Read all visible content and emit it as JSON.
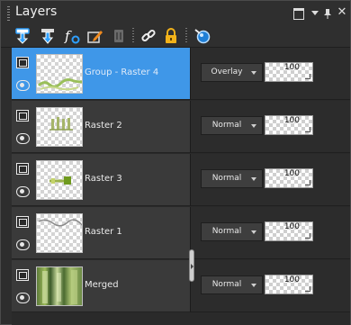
{
  "panel": {
    "title": "Layers",
    "window_buttons": {
      "restore_icon": "restore-window-icon",
      "menu_icon": "chevron-down-icon",
      "pin_icon": "pin-icon",
      "close_icon": "close-icon",
      "close_glyph": "✕"
    }
  },
  "toolbar": {
    "buttons": [
      {
        "icon": "new-raster-layer-icon"
      },
      {
        "icon": "new-vector-layer-icon"
      },
      {
        "icon": "layer-effects-icon"
      },
      {
        "icon": "edit-layer-icon"
      },
      {
        "icon": "delete-layer-icon"
      },
      {
        "icon": "link-icon"
      },
      {
        "icon": "lock-icon"
      },
      {
        "icon": "layer-properties-icon"
      }
    ]
  },
  "layers": [
    {
      "name": "Group - Raster 4",
      "blend_mode": "Overlay",
      "opacity": "100",
      "selected": true
    },
    {
      "name": "Raster 2",
      "blend_mode": "Normal",
      "opacity": "100",
      "selected": false
    },
    {
      "name": "Raster 3",
      "blend_mode": "Normal",
      "opacity": "100",
      "selected": false
    },
    {
      "name": "Raster 1",
      "blend_mode": "Normal",
      "opacity": "100",
      "selected": false
    },
    {
      "name": "Merged",
      "blend_mode": "Normal",
      "opacity": "100",
      "selected": false
    }
  ],
  "colors": {
    "selection": "#3f97e8",
    "panel_bg": "#2d2d2d",
    "row_bg": "#3a3a3a"
  }
}
